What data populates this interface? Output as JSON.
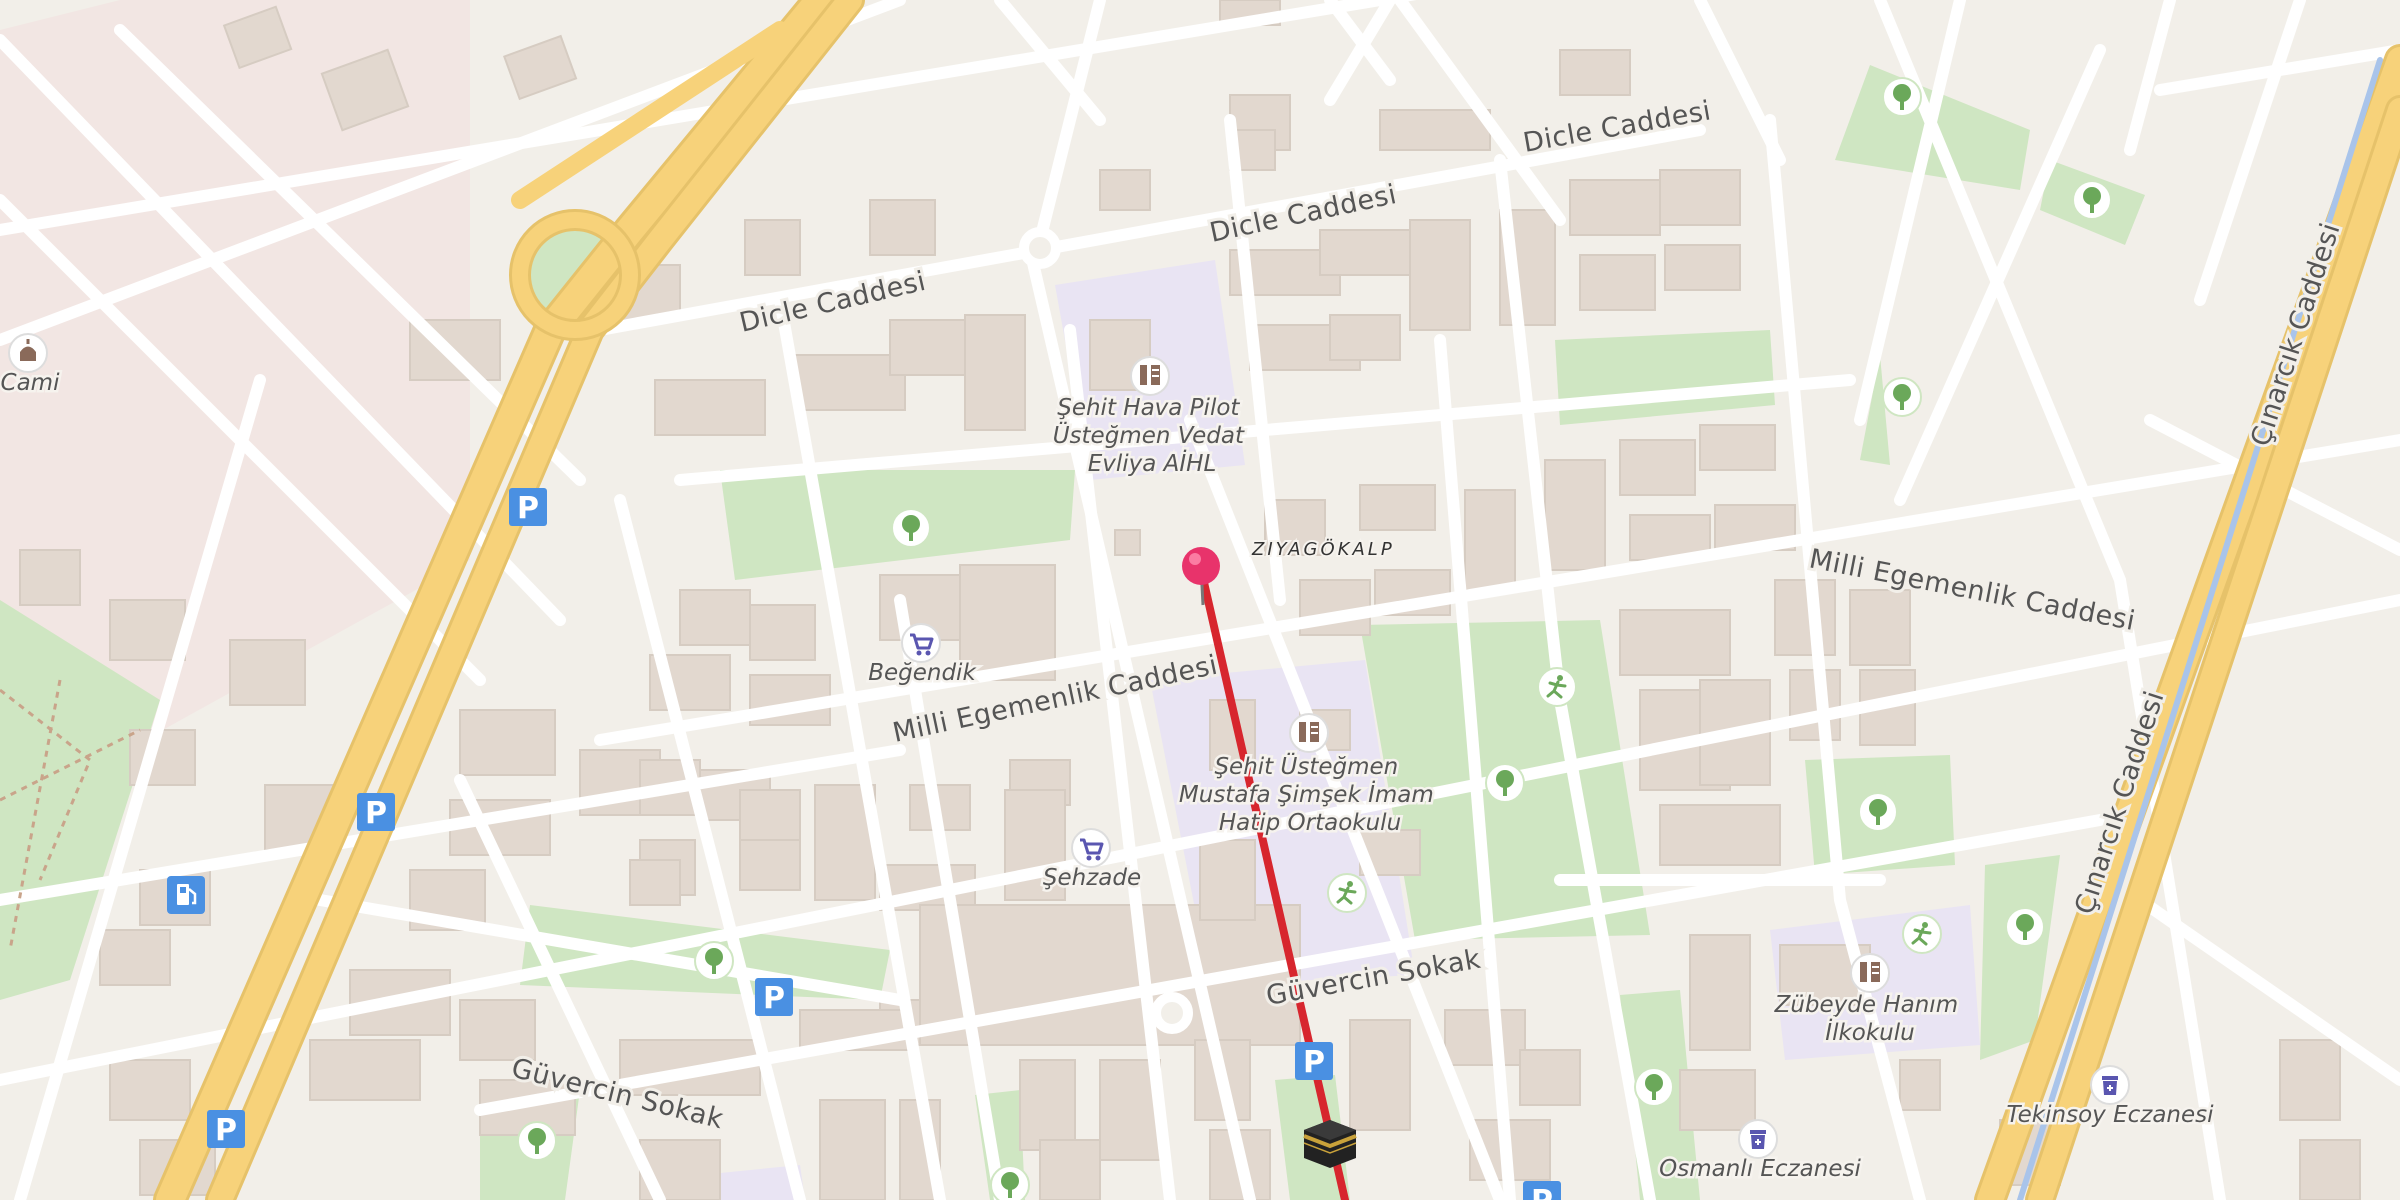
{
  "map": {
    "streets": {
      "dicle_1": "Dicle Caddesi",
      "dicle_2": "Dicle Caddesi",
      "dicle_3": "Dicle Caddesi",
      "milli_1": "Milli Egemenlik Caddesi",
      "milli_2": "Milli Egemenlik Caddesi",
      "guvercin_1": "Güvercin Sokak",
      "guvercin_2": "Güvercin Sokak",
      "cinarcik_1": "Çınarcık Caddesi",
      "cinarcik_2": "Çınarcık Caddesi"
    },
    "neighborhood": "ZIYAGÖKALP",
    "pois": {
      "school_1": {
        "line1": "Şehit Hava Pilot",
        "line2": "Üsteğmen Vedat",
        "line3": "Evliya AİHL"
      },
      "school_2": {
        "line1": "Şehit Üsteğmen",
        "line2": "Mustafa Şimşek İmam",
        "line3": "Hatip Ortaokulu"
      },
      "school_3": {
        "line1": "Zübeyde Hanım",
        "line2": "İlkokulu"
      },
      "shop_1": "Beğendik",
      "shop_2": "Şehzade",
      "pharmacy_1": "Tekinsoy Eczanesi",
      "pharmacy_2": "Osmanlı Eczanesi",
      "mosque": "Cami"
    },
    "icons": {
      "parking_glyph": "P",
      "parking_color": "#4a90e2",
      "park_color": "#cde8c0",
      "school_area_color": "#ebe6f5",
      "route_color": "#d7262e",
      "pin_color": "#e8336b",
      "major_road_color": "#f7d27a"
    }
  }
}
